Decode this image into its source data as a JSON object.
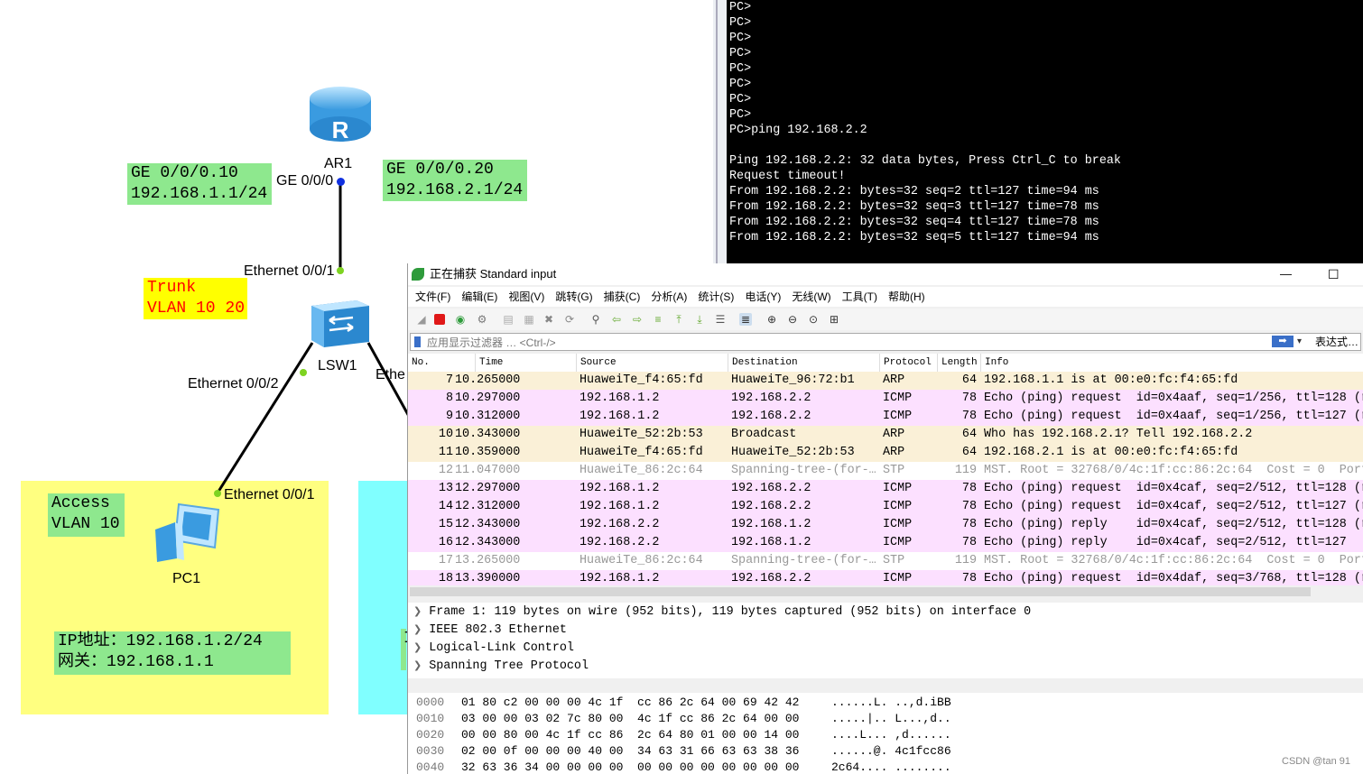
{
  "topology": {
    "router": {
      "name": "AR1",
      "port": "GE 0/0/0"
    },
    "switch": {
      "name": "LSW1",
      "port_up": "Ethernet 0/0/1",
      "port_left": "Ethernet 0/0/2",
      "port_right_partial": "Ethe"
    },
    "pc": {
      "name": "PC1",
      "port": "Ethernet 0/0/1"
    },
    "notes": {
      "sub1": "GE 0/0/0.10\n192.168.1.1/24",
      "sub2": "GE 0/0/0.20\n192.168.2.1/24",
      "trunk": "Trunk\nVLAN 10 20",
      "access": "Access\nVLAN 10",
      "ipconf": "IP地址：192.168.1.2/24\n网关：192.168.1.1",
      "partial": "I"
    },
    "colors": {
      "green_note": "#8ee88e",
      "yellow_note": "#ffff00",
      "zone_yellow": "#ffff80",
      "zone_cyan": "#80ffff",
      "red_text": "#ff0000"
    }
  },
  "terminal": {
    "lines": [
      "PC>",
      "PC>",
      "PC>",
      "PC>",
      "PC>",
      "PC>",
      "PC>",
      "PC>",
      "PC>ping 192.168.2.2",
      "",
      "Ping 192.168.2.2: 32 data bytes, Press Ctrl_C to break",
      "Request timeout!",
      "From 192.168.2.2: bytes=32 seq=2 ttl=127 time=94 ms",
      "From 192.168.2.2: bytes=32 seq=3 ttl=127 time=78 ms",
      "From 192.168.2.2: bytes=32 seq=4 ttl=127 time=78 ms",
      "From 192.168.2.2: bytes=32 seq=5 ttl=127 time=94 ms"
    ]
  },
  "wireshark": {
    "title": "正在捕获 Standard input",
    "window_controls": {
      "minimize": "—",
      "maximize": "☐"
    },
    "menu": [
      "文件(F)",
      "编辑(E)",
      "视图(V)",
      "跳转(G)",
      "捕获(C)",
      "分析(A)",
      "统计(S)",
      "电话(Y)",
      "无线(W)",
      "工具(T)",
      "帮助(H)"
    ],
    "filter": {
      "placeholder": "应用显示过滤器 … <Ctrl-/>",
      "expression_label": "表达式…"
    },
    "columns": [
      "No.",
      "Time",
      "Source",
      "Destination",
      "Protocol",
      "Length",
      "Info"
    ],
    "packets": [
      {
        "no": "7",
        "time": "10.265000",
        "src": "HuaweiTe_f4:65:fd",
        "dst": "HuaweiTe_96:72:b1",
        "proto": "ARP",
        "len": "64",
        "info": "192.168.1.1 is at 00:e0:fc:f4:65:fd",
        "kind": "arp"
      },
      {
        "no": "8",
        "time": "10.297000",
        "src": "192.168.1.2",
        "dst": "192.168.2.2",
        "proto": "ICMP",
        "len": "78",
        "info": "Echo (ping) request  id=0x4aaf, seq=1/256, ttl=128 (r",
        "kind": "icmp"
      },
      {
        "no": "9",
        "time": "10.312000",
        "src": "192.168.1.2",
        "dst": "192.168.2.2",
        "proto": "ICMP",
        "len": "78",
        "info": "Echo (ping) request  id=0x4aaf, seq=1/256, ttl=127 (r",
        "kind": "icmp"
      },
      {
        "no": "10",
        "time": "10.343000",
        "src": "HuaweiTe_52:2b:53",
        "dst": "Broadcast",
        "proto": "ARP",
        "len": "64",
        "info": "Who has 192.168.2.1? Tell 192.168.2.2",
        "kind": "arp"
      },
      {
        "no": "11",
        "time": "10.359000",
        "src": "HuaweiTe_f4:65:fd",
        "dst": "HuaweiTe_52:2b:53",
        "proto": "ARP",
        "len": "64",
        "info": "192.168.2.1 is at 00:e0:fc:f4:65:fd",
        "kind": "arp"
      },
      {
        "no": "12",
        "time": "11.047000",
        "src": "HuaweiTe_86:2c:64",
        "dst": "Spanning-tree-(for-…",
        "proto": "STP",
        "len": "119",
        "info": "MST. Root = 32768/0/4c:1f:cc:86:2c:64  Cost = 0  Port",
        "kind": "stp"
      },
      {
        "no": "13",
        "time": "12.297000",
        "src": "192.168.1.2",
        "dst": "192.168.2.2",
        "proto": "ICMP",
        "len": "78",
        "info": "Echo (ping) request  id=0x4caf, seq=2/512, ttl=128 (r",
        "kind": "icmp"
      },
      {
        "no": "14",
        "time": "12.312000",
        "src": "192.168.1.2",
        "dst": "192.168.2.2",
        "proto": "ICMP",
        "len": "78",
        "info": "Echo (ping) request  id=0x4caf, seq=2/512, ttl=127 (r",
        "kind": "icmp"
      },
      {
        "no": "15",
        "time": "12.343000",
        "src": "192.168.2.2",
        "dst": "192.168.1.2",
        "proto": "ICMP",
        "len": "78",
        "info": "Echo (ping) reply    id=0x4caf, seq=2/512, ttl=128 (r",
        "kind": "icmp"
      },
      {
        "no": "16",
        "time": "12.343000",
        "src": "192.168.2.2",
        "dst": "192.168.1.2",
        "proto": "ICMP",
        "len": "78",
        "info": "Echo (ping) reply    id=0x4caf, seq=2/512, ttl=127",
        "kind": "icmp"
      },
      {
        "no": "17",
        "time": "13.265000",
        "src": "HuaweiTe_86:2c:64",
        "dst": "Spanning-tree-(for-…",
        "proto": "STP",
        "len": "119",
        "info": "MST. Root = 32768/0/4c:1f:cc:86:2c:64  Cost = 0  Port",
        "kind": "stp"
      },
      {
        "no": "18",
        "time": "13.390000",
        "src": "192.168.1.2",
        "dst": "192.168.2.2",
        "proto": "ICMP",
        "len": "78",
        "info": "Echo (ping) request  id=0x4daf, seq=3/768, ttl=128 (r",
        "kind": "icmp"
      }
    ],
    "row_colors": {
      "arp": "#faf0d7",
      "icmp": "#fce0ff",
      "stp": "#ffffff"
    },
    "details": [
      "Frame 1: 119 bytes on wire (952 bits), 119 bytes captured (952 bits) on interface 0",
      "IEEE 802.3 Ethernet",
      "Logical-Link Control",
      "Spanning Tree Protocol"
    ],
    "bytes": [
      {
        "off": "0000",
        "hex": "01 80 c2 00 00 00 4c 1f  cc 86 2c 64 00 69 42 42",
        "ascii": "......L. ..,d.iBB"
      },
      {
        "off": "0010",
        "hex": "03 00 00 03 02 7c 80 00  4c 1f cc 86 2c 64 00 00",
        "ascii": ".....|.. L...,d.."
      },
      {
        "off": "0020",
        "hex": "00 00 80 00 4c 1f cc 86  2c 64 80 01 00 00 14 00",
        "ascii": "....L... ,d......"
      },
      {
        "off": "0030",
        "hex": "02 00 0f 00 00 00 40 00  34 63 31 66 63 63 38 36",
        "ascii": "......@. 4c1fcc86"
      },
      {
        "off": "0040",
        "hex": "32 63 36 34 00 00 00 00  00 00 00 00 00 00 00 00",
        "ascii": "2c64.... ........"
      }
    ]
  },
  "watermark": "CSDN @tan 91"
}
